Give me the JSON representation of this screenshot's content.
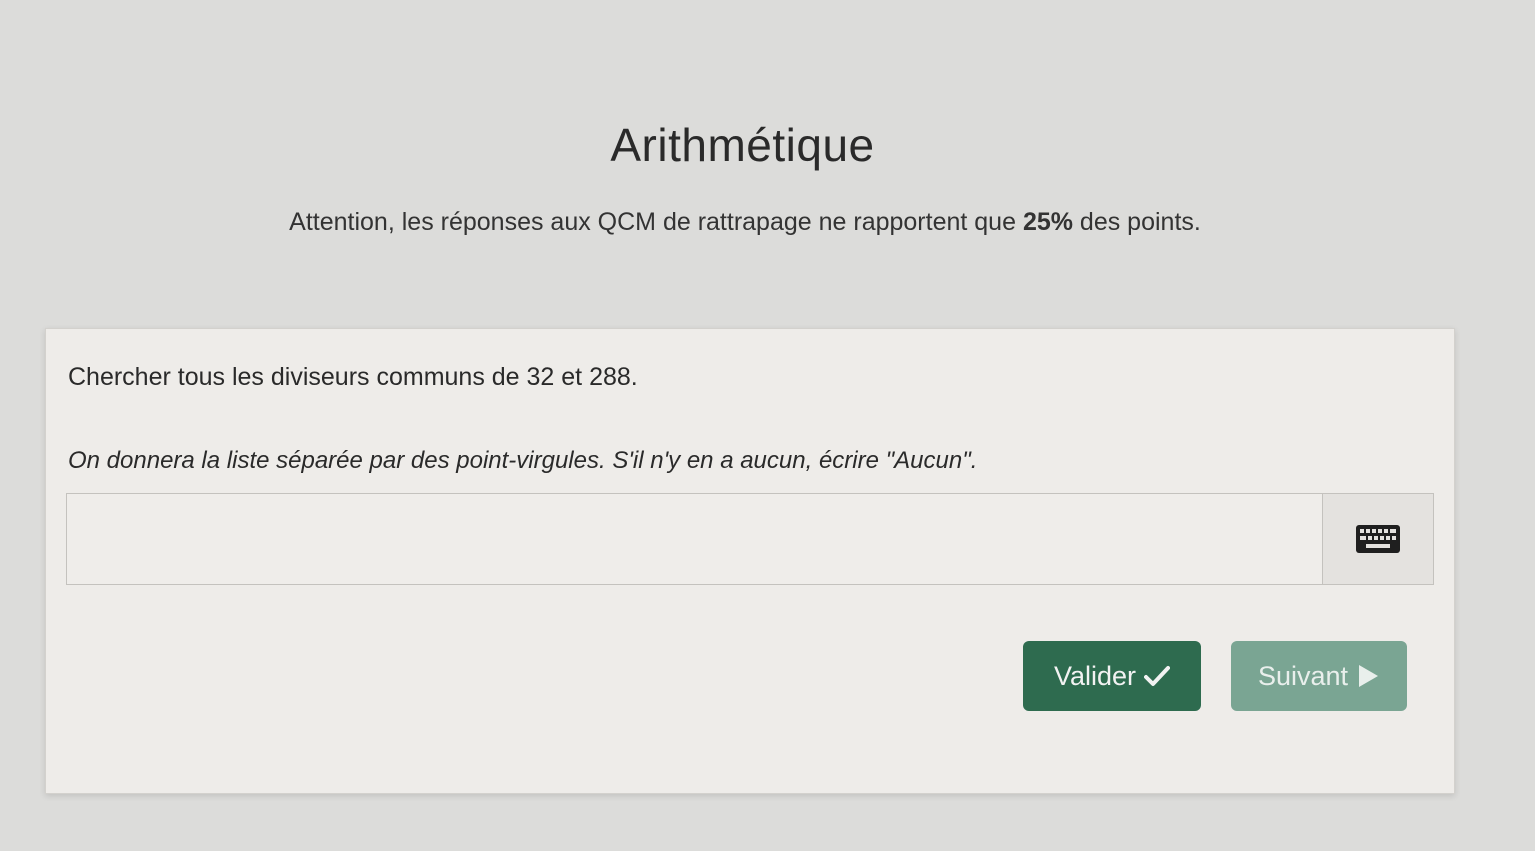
{
  "header": {
    "title": "Arithmétique",
    "notice_before": "Attention, les réponses aux QCM de rattrapage ne rapportent que ",
    "notice_bold": "25%",
    "notice_after": " des points."
  },
  "exercise": {
    "question": "Chercher tous les diviseurs communs de 32 et 288.",
    "instruction": "On donnera la liste séparée par des point-virgules. S'il n'y en a aucun, écrire \"Aucun\".",
    "answer_value": "",
    "keyboard_icon": "keyboard-icon"
  },
  "actions": {
    "validate_label": "Valider",
    "validate_icon": "check-icon",
    "next_label": "Suivant",
    "next_icon": "play-icon"
  },
  "colors": {
    "validate_button": "#2e6b4f",
    "next_button": "#7aa593",
    "background": "#dcdcda",
    "card": "#eeece9"
  }
}
